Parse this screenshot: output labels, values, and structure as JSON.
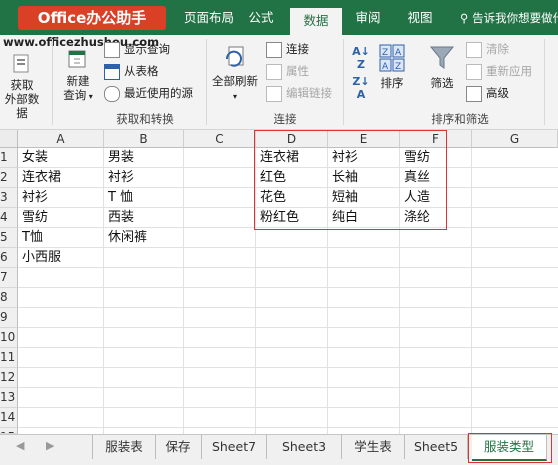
{
  "brand": {
    "logo_text": "Office办公助手",
    "site": "www.officezhushou.com"
  },
  "ribbon_tabs": [
    "页面布局",
    "公式",
    "数据",
    "审阅",
    "视图"
  ],
  "active_tab": "数据",
  "tell_me": "告诉我你想要做什么",
  "ribbon": {
    "get_external": {
      "label_line1": "获取",
      "label_line2": "外部数据"
    },
    "new_query": {
      "label_line1": "新建",
      "label_line2": "查询"
    },
    "show_query": "显示查询",
    "from_table": "从表格",
    "recent_sources": "最近使用的源",
    "group_get_transform": "获取和转换",
    "refresh_all": "全部刷新",
    "connections": "连接",
    "properties": "属性",
    "edit_links": "编辑链接",
    "group_connections": "连接",
    "sort": "排序",
    "filter": "筛选",
    "clear": "清除",
    "reapply": "重新应用",
    "advanced": "高级",
    "group_sort_filter": "排序和筛选"
  },
  "grid": {
    "columns": [
      "A",
      "B",
      "C",
      "D",
      "E",
      "F",
      "G"
    ],
    "rows": [
      "1",
      "2",
      "3",
      "4",
      "5",
      "6",
      "7",
      "8",
      "9",
      "10",
      "11",
      "12",
      "13",
      "14",
      "15"
    ],
    "colA": [
      "女装",
      "连衣裙",
      "衬衫",
      "雪纺",
      "T恤",
      "小西服"
    ],
    "colB": [
      "男装",
      "衬衫",
      "T 恤",
      "西装",
      "休闲裤"
    ],
    "colD": [
      "连衣裙",
      "红色",
      "花色",
      "粉红色"
    ],
    "colE": [
      "衬衫",
      "长袖",
      "短袖",
      "纯白"
    ],
    "colF": [
      "雪纺",
      "真丝",
      "人造",
      "涤纶"
    ]
  },
  "sheet_tabs": [
    "服装表",
    "保存",
    "Sheet7",
    "Sheet3",
    "学生表",
    "Sheet5",
    "服装类型"
  ],
  "active_sheet": "服装类型"
}
